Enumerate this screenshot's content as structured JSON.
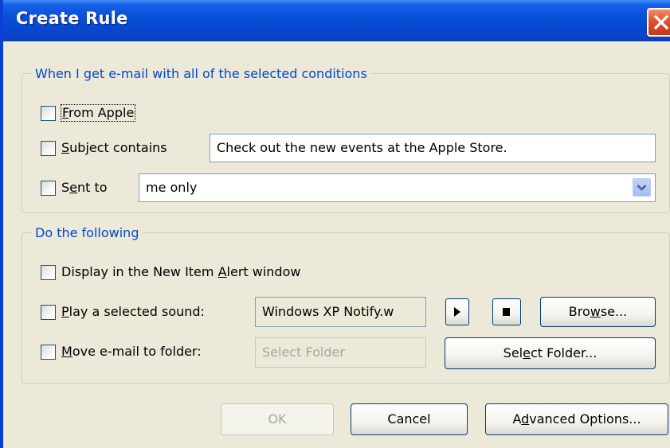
{
  "window": {
    "title": "Create Rule"
  },
  "conditions": {
    "legend": "When I get e-mail with all of the selected conditions",
    "from": {
      "label_prefix": "",
      "label_accel": "F",
      "label_rest": "rom Apple",
      "checked": false
    },
    "subject": {
      "label_prefix": "",
      "label_accel": "S",
      "label_rest": "ubject contains",
      "checked": false,
      "value": "Check out the new events at the Apple Store."
    },
    "sent_to": {
      "label_prefix": "S",
      "label_accel": "e",
      "label_rest": "nt to",
      "checked": false,
      "value": "me only"
    }
  },
  "actions": {
    "legend": "Do the following",
    "alert": {
      "label_prefix": "Display in the New Item ",
      "label_accel": "A",
      "label_rest": "lert window",
      "checked": false
    },
    "sound": {
      "label_prefix": "",
      "label_accel": "P",
      "label_rest": "lay a selected sound:",
      "checked": false,
      "value": "Windows XP Notify.w"
    },
    "browse": {
      "label_prefix": "Bro",
      "label_accel": "w",
      "label_rest": "se..."
    },
    "move": {
      "label_prefix": "",
      "label_accel": "M",
      "label_rest": "ove e-mail to folder:",
      "checked": false,
      "placeholder": "Select Folder"
    },
    "select_folder": {
      "label_prefix": "Sel",
      "label_accel": "e",
      "label_rest": "ct Folder..."
    }
  },
  "footer": {
    "ok_label": "OK",
    "cancel_label": "Cancel",
    "advanced": {
      "label_prefix": "A",
      "label_accel": "d",
      "label_rest": "vanced Options..."
    }
  },
  "icons": {
    "close": "close-icon",
    "dropdown": "chevron-down-icon",
    "play": "play-icon",
    "stop": "stop-icon"
  },
  "colors": {
    "titlebar": "#0a4fd8",
    "dialog_bg": "#ece9d8",
    "legend_text": "#0046d5",
    "close_button": "#e0532c",
    "button_border": "#003c74"
  }
}
